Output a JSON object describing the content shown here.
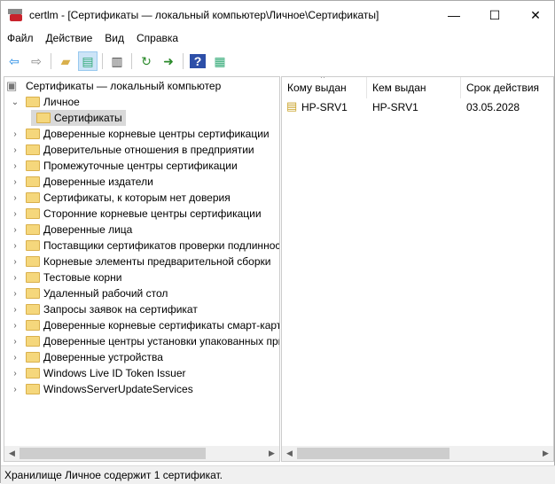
{
  "window": {
    "title": "certlm - [Сертификаты — локальный компьютер\\Личное\\Сертификаты]",
    "minimize": "—",
    "maximize": "☐",
    "close": "✕"
  },
  "menu": [
    "Файл",
    "Действие",
    "Вид",
    "Справка"
  ],
  "toolbar": [
    {
      "icon": "back-icon",
      "glyph": "⇦",
      "color": "#1e88e5"
    },
    {
      "icon": "forward-icon",
      "glyph": "⇨",
      "color": "#888"
    },
    {
      "icon": "up-folder-icon",
      "glyph": "▰",
      "color": "#d9b04c"
    },
    {
      "icon": "show-hide-tree-icon",
      "glyph": "▤",
      "color": "#3a7"
    },
    {
      "icon": "clipboard-icon",
      "glyph": "▥",
      "color": "#444"
    },
    {
      "icon": "refresh-icon",
      "glyph": "↻",
      "color": "#2a8a2a"
    },
    {
      "icon": "export-list-icon",
      "glyph": "➜",
      "color": "#2a8a2a"
    },
    {
      "icon": "help-icon",
      "glyph": "?",
      "color": "#fff"
    },
    {
      "icon": "action-pane-icon",
      "glyph": "▦",
      "color": "#3a7"
    }
  ],
  "tree": {
    "root": "Сертификаты — локальный компьютер",
    "personal": "Личное",
    "certs": "Сертификаты",
    "items": [
      "Доверенные корневые центры сертификации",
      "Доверительные отношения в предприятии",
      "Промежуточные центры сертификации",
      "Доверенные издатели",
      "Сертификаты, к которым нет доверия",
      "Сторонние корневые центры сертификации",
      "Доверенные лица",
      "Поставщики сертификатов проверки подлинности клиентов",
      "Корневые элементы предварительной сборки",
      "Тестовые корни",
      "Удаленный рабочий стол",
      "Запросы заявок на сертификат",
      "Доверенные корневые сертификаты смарт-карт",
      "Доверенные центры установки упакованных приложений",
      "Доверенные устройства",
      "Windows Live ID Token Issuer",
      "WindowsServerUpdateServices"
    ]
  },
  "list": {
    "columns": [
      "Кому выдан",
      "Кем выдан",
      "Срок действия"
    ],
    "rows": [
      {
        "issued_to": "HP-SRV1",
        "issued_by": "HP-SRV1",
        "expires": "03.05.2028"
      }
    ]
  },
  "status": "Хранилище Личное содержит 1 сертификат."
}
